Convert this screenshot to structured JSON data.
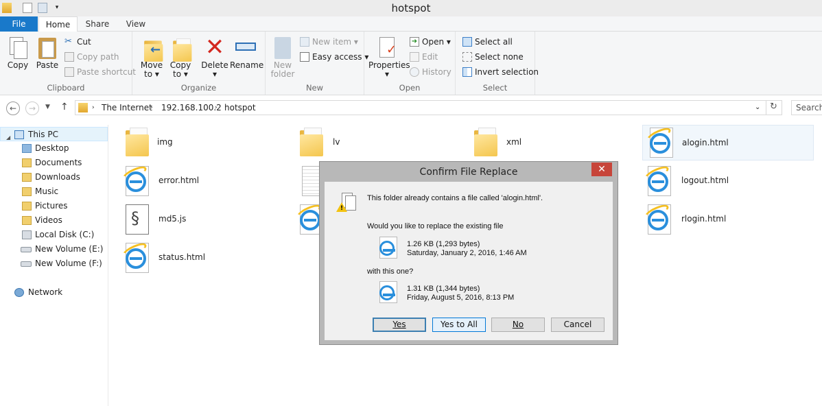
{
  "window": {
    "title": "hotspot"
  },
  "ribbon": {
    "tabs": [
      "File",
      "Home",
      "Share",
      "View"
    ],
    "clipboard": {
      "copy": "Copy",
      "paste": "Paste",
      "cut": "Cut",
      "copy_path": "Copy path",
      "paste_shortcut": "Paste shortcut",
      "label": "Clipboard"
    },
    "organize": {
      "move_to_1": "Move",
      "move_to_2": "to",
      "copy_to_1": "Copy",
      "copy_to_2": "to",
      "delete": "Delete",
      "rename": "Rename",
      "label": "Organize"
    },
    "new": {
      "new_folder_1": "New",
      "new_folder_2": "folder",
      "new_item": "New item",
      "easy_access": "Easy access",
      "label": "New"
    },
    "open": {
      "properties": "Properties",
      "open": "Open",
      "edit": "Edit",
      "history": "History",
      "label": "Open"
    },
    "select": {
      "select_all": "Select all",
      "select_none": "Select none",
      "invert": "Invert selection",
      "label": "Select"
    }
  },
  "address": {
    "crumbs": [
      "The Internet",
      "192.168.100.2",
      "hotspot"
    ],
    "search_placeholder": "Search"
  },
  "nav": {
    "this_pc": "This PC",
    "items": [
      "Desktop",
      "Documents",
      "Downloads",
      "Music",
      "Pictures",
      "Videos",
      "Local Disk (C:)",
      "New Volume (E:)",
      "New Volume (F:)"
    ],
    "network": "Network"
  },
  "files": [
    {
      "name": "img",
      "type": "folder"
    },
    {
      "name": "lv",
      "type": "folder"
    },
    {
      "name": "xml",
      "type": "folder"
    },
    {
      "name": "alogin.html",
      "type": "html"
    },
    {
      "name": "error.html",
      "type": "html"
    },
    {
      "name": "logout.html",
      "type": "html"
    },
    {
      "name": "md5.js",
      "type": "js"
    },
    {
      "name": "rlogin.html",
      "type": "html"
    },
    {
      "name": "status.html",
      "type": "html"
    }
  ],
  "dialog": {
    "title": "Confirm File Replace",
    "close": "✕",
    "message": "This folder already contains a file called 'alogin.html'.",
    "question": "Would you like to replace the existing file",
    "existing_size": "1.26 KB (1,293 bytes)",
    "existing_date": "Saturday, January 2, 2016, 1:46 AM",
    "with": "with this one?",
    "new_size": "1.31 KB (1,344 bytes)",
    "new_date": "Friday, August 5, 2016, 8:13 PM",
    "buttons": {
      "yes": "Yes",
      "yes_all": "Yes to All",
      "no": "No",
      "cancel": "Cancel"
    }
  }
}
